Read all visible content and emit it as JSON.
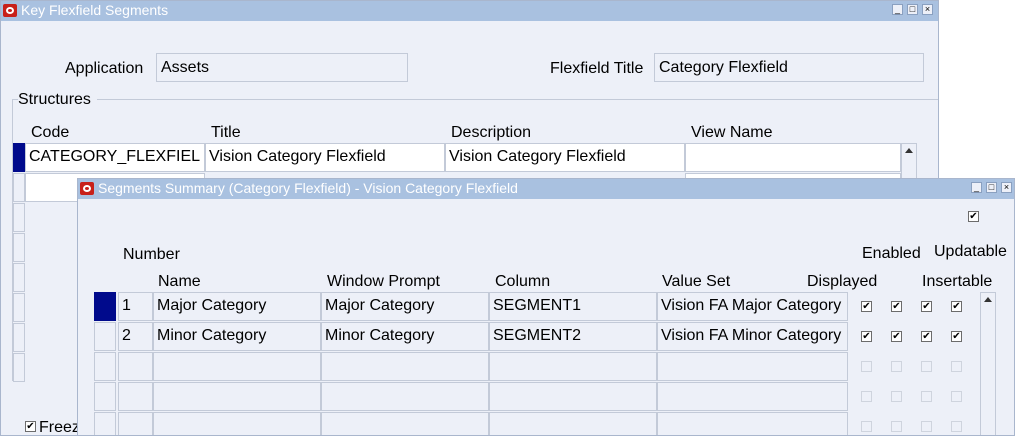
{
  "key_window": {
    "title": "Key Flexfield Segments",
    "application_label": "Application",
    "application_value": "Assets",
    "flexfield_title_label": "Flexfield Title",
    "flexfield_title_value": "Category Flexfield",
    "structures_label": "Structures",
    "columns": {
      "code": "Code",
      "title": "Title",
      "description": "Description",
      "view_name": "View Name"
    },
    "rows": [
      {
        "code": "CATEGORY_FLEXFIEL",
        "title": "Vision Category Flexfield",
        "description": "Vision Category Flexfield",
        "view_name": ""
      }
    ],
    "freeze_label": "Freez"
  },
  "segments_window": {
    "title": "Segments Summary (Category Flexfield) - Vision Category Flexfield",
    "columns": {
      "number": "Number",
      "name": "Name",
      "window_prompt": "Window Prompt",
      "column": "Column",
      "value_set": "Value Set",
      "displayed": "Displayed",
      "enabled": "Enabled",
      "updatable": "Updatable",
      "insertable": "Insertable"
    },
    "rows": [
      {
        "number": "1",
        "name": "Major Category",
        "window_prompt": "Major Category",
        "column": "SEGMENT1",
        "value_set": "Vision FA Major Category",
        "displayed": true,
        "enabled": true,
        "updatable": true,
        "insertable": true
      },
      {
        "number": "2",
        "name": "Minor Category",
        "window_prompt": "Minor Category",
        "column": "SEGMENT2",
        "value_set": "Vision FA Minor Category",
        "displayed": true,
        "enabled": true,
        "updatable": true,
        "insertable": true
      }
    ],
    "check_mark": "✔"
  },
  "colors": {
    "selected_row": "#000a8c",
    "titlebar": "#a9c1e0",
    "background": "#edf0f8"
  }
}
